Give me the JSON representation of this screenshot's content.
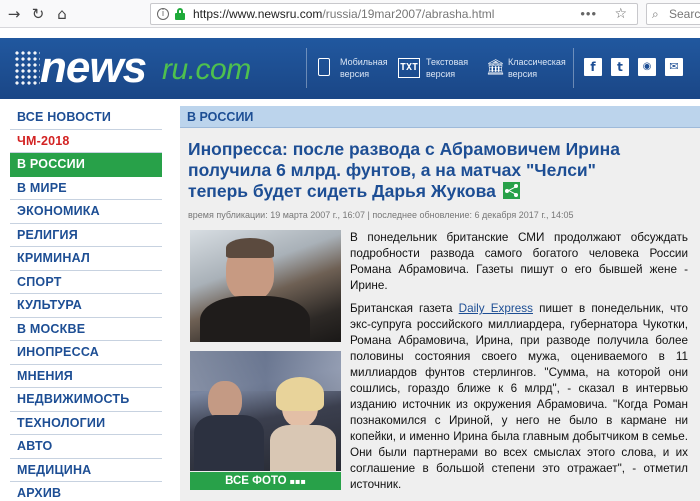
{
  "browser": {
    "url_host": "https://www.newsru.com",
    "url_path": "/russia/19mar2007/abrasha.html",
    "more_glyph": "•••",
    "search_placeholder": "Search",
    "icons": [
      "back-arrow-icon",
      "reload-icon",
      "home-icon",
      "info-icon",
      "lock-icon",
      "bookmark-star-icon",
      "search-icon"
    ]
  },
  "header": {
    "logo_main": "news",
    "logo_suffix": "ru.com",
    "versions": [
      {
        "label_line1": "Мобильная",
        "label_line2": "версия"
      },
      {
        "label_line1": "Текстовая",
        "label_line2": "версия",
        "badge": "TXT"
      },
      {
        "label_line1": "Классическая",
        "label_line2": "версия"
      }
    ],
    "social": [
      {
        "name": "facebook-icon",
        "glyph": "f"
      },
      {
        "name": "twitter-icon",
        "glyph": "t"
      },
      {
        "name": "rss-icon",
        "glyph": "◉"
      },
      {
        "name": "vk-icon",
        "glyph": "✉"
      }
    ],
    "colors": {
      "header_blue": "#1d4e94",
      "accent_green": "#28a149",
      "logo_green": "#4ec04e"
    }
  },
  "sidebar": {
    "items": [
      {
        "label": "ВСЕ НОВОСТИ",
        "style": "normal"
      },
      {
        "label": "ЧМ-2018",
        "style": "red"
      },
      {
        "label": "В РОССИИ",
        "style": "active"
      },
      {
        "label": "В МИРЕ",
        "style": "normal"
      },
      {
        "label": "ЭКОНОМИКА",
        "style": "normal"
      },
      {
        "label": "РЕЛИГИЯ",
        "style": "normal"
      },
      {
        "label": "КРИМИНАЛ",
        "style": "normal"
      },
      {
        "label": "СПОРТ",
        "style": "normal"
      },
      {
        "label": "КУЛЬТУРА",
        "style": "normal"
      },
      {
        "label": "В МОСКВЕ",
        "style": "normal"
      },
      {
        "label": "ИНОПРЕССА",
        "style": "normal"
      },
      {
        "label": "МНЕНИЯ",
        "style": "normal"
      },
      {
        "label": "НЕДВИЖИМОСТЬ",
        "style": "normal"
      },
      {
        "label": "ТЕХНОЛОГИИ",
        "style": "normal"
      },
      {
        "label": "АВТО",
        "style": "normal"
      },
      {
        "label": "МЕДИЦИНА",
        "style": "normal"
      },
      {
        "label": "АРХИВ",
        "style": "normal"
      }
    ]
  },
  "article": {
    "section": "В РОССИИ",
    "title": "Инопресса: после развода с Абрамовичем Ирина получила 6 млрд. фунтов, а на матчах \"Челси\" теперь будет сидеть Дарья Жукова",
    "meta": "время публикации: 19 марта 2007 г., 16:07 | последнее обновление: 6 декабря 2017 г., 14:05",
    "photo_button": "ВСЕ ФОТО",
    "paragraph1": "В понедельник британские СМИ продолжают обсуждать подробности развода самого богатого человека России Романа Абрамовича. Газеты пишут о его бывшей жене - Ирине.",
    "paragraph2_before": "Британская газета ",
    "paragraph2_link": "Daily Express",
    "paragraph2_after": " пишет в понедельник, что экс-супруга российского миллиардера, губернатора Чукотки, Романа Абрамовича, Ирина, при разводе получила более половины состояния своего мужа, оцениваемого в 11 миллиардов фунтов стерлингов. \"Сумма, на которой они сошлись, гораздо ближе к 6 млрд\", - сказал в интервью изданию источник из окружения Абрамовича. \"Когда Роман познакомился с Ириной, у него не было в кармане ни копейки, и именно Ирина была главным добытчиком в семье. Они были партнерами во всех смыслах этого слова, и их соглашение в большой степени это отражает\", - отметил источник."
  }
}
